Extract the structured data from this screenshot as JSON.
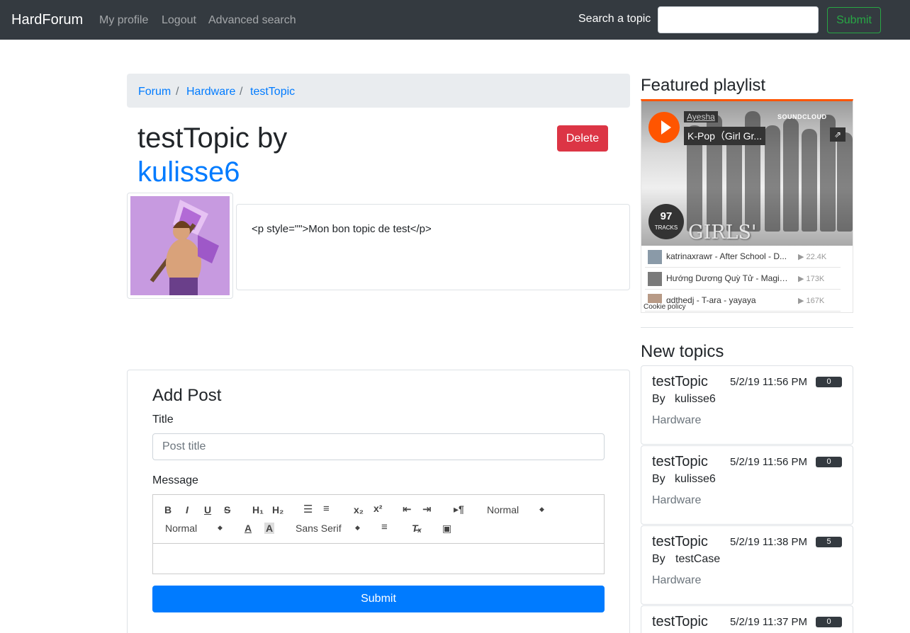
{
  "navbar": {
    "brand": "HardForum",
    "links": [
      "My profile",
      "Logout",
      "Advanced search"
    ],
    "search_label": "Search a topic",
    "search_value": "",
    "submit_label": "Submit"
  },
  "breadcrumb": [
    "Forum",
    "Hardware",
    "testTopic"
  ],
  "topic": {
    "title": "testTopic by",
    "author": "kulisse6",
    "delete_label": "Delete",
    "message": "<p style=\"\">Mon bon topic de test</p>"
  },
  "add_post": {
    "heading": "Add Post",
    "title_label": "Title",
    "title_placeholder": "Post title",
    "message_label": "Message",
    "toolbar": {
      "header_select": "Normal",
      "size_select": "Normal",
      "font_select": "Sans Serif"
    },
    "submit_label": "Submit"
  },
  "sidebar": {
    "playlist_heading": "Featured playlist",
    "player": {
      "uploader": "Ayesha",
      "playlist_title": "K-Pop（Girl Gr...",
      "brand": "SOUNDCLOUD",
      "track_count": "97",
      "track_count_label": "TRACKS",
      "artwork_text": "GIRLS' GENERATION",
      "tracks": [
        {
          "name": "katrinaxrawr - After School - D...",
          "plays": "22.4K"
        },
        {
          "name": "Hướng Dương Quỳ Tử - Magic ...",
          "plays": "173K"
        },
        {
          "name": "gdthedj - T-ara - yayaya",
          "plays": "167K"
        }
      ],
      "cookie_policy": "Cookie policy"
    },
    "new_topics_heading": "New topics",
    "new_topics": [
      {
        "title": "testTopic",
        "date": "5/2/19 11:56 PM",
        "count": "0",
        "by": "By",
        "author": "kulisse6",
        "category": "Hardware"
      },
      {
        "title": "testTopic",
        "date": "5/2/19 11:56 PM",
        "count": "0",
        "by": "By",
        "author": "kulisse6",
        "category": "Hardware"
      },
      {
        "title": "testTopic",
        "date": "5/2/19 11:38 PM",
        "count": "5",
        "by": "By",
        "author": "testCase",
        "category": "Hardware"
      },
      {
        "title": "testTopic",
        "date": "5/2/19 11:37 PM",
        "count": "0",
        "by": "By",
        "author": "",
        "category": ""
      }
    ]
  },
  "colors": {
    "navbar_bg": "#343a40",
    "link": "#007bff",
    "danger": "#dc3545",
    "success": "#28a745",
    "soundcloud": "#ff5500"
  }
}
